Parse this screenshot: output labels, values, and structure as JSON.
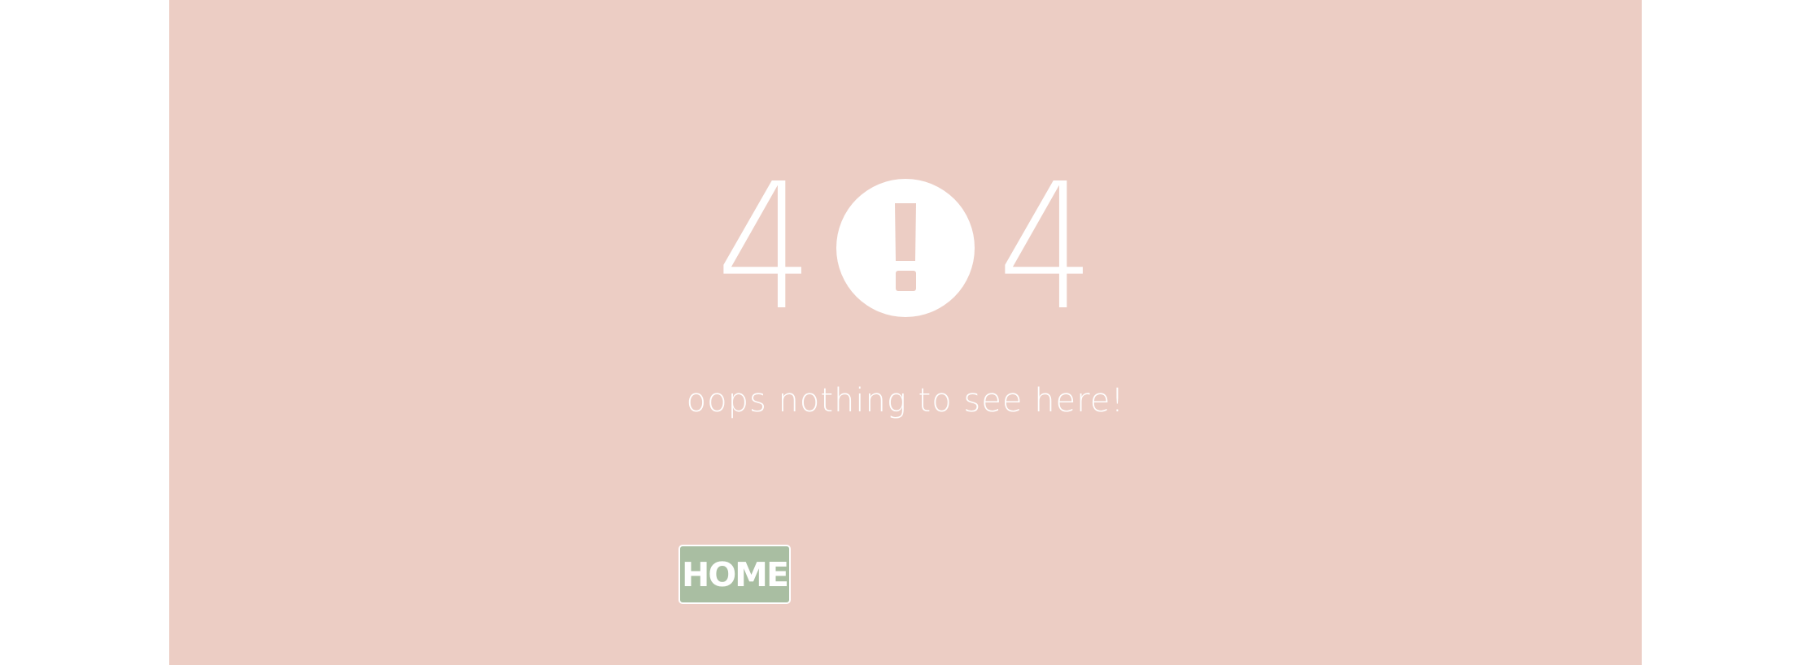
{
  "error": {
    "digit_left": "4",
    "digit_right": "4",
    "middle_icon": "exclamation-circle-icon"
  },
  "message": "oops nothing to see here!",
  "home_button": {
    "label": "HOME"
  },
  "colors": {
    "background": "#eccdc4",
    "foreground": "#ffffff",
    "button": "#a9bea2"
  }
}
